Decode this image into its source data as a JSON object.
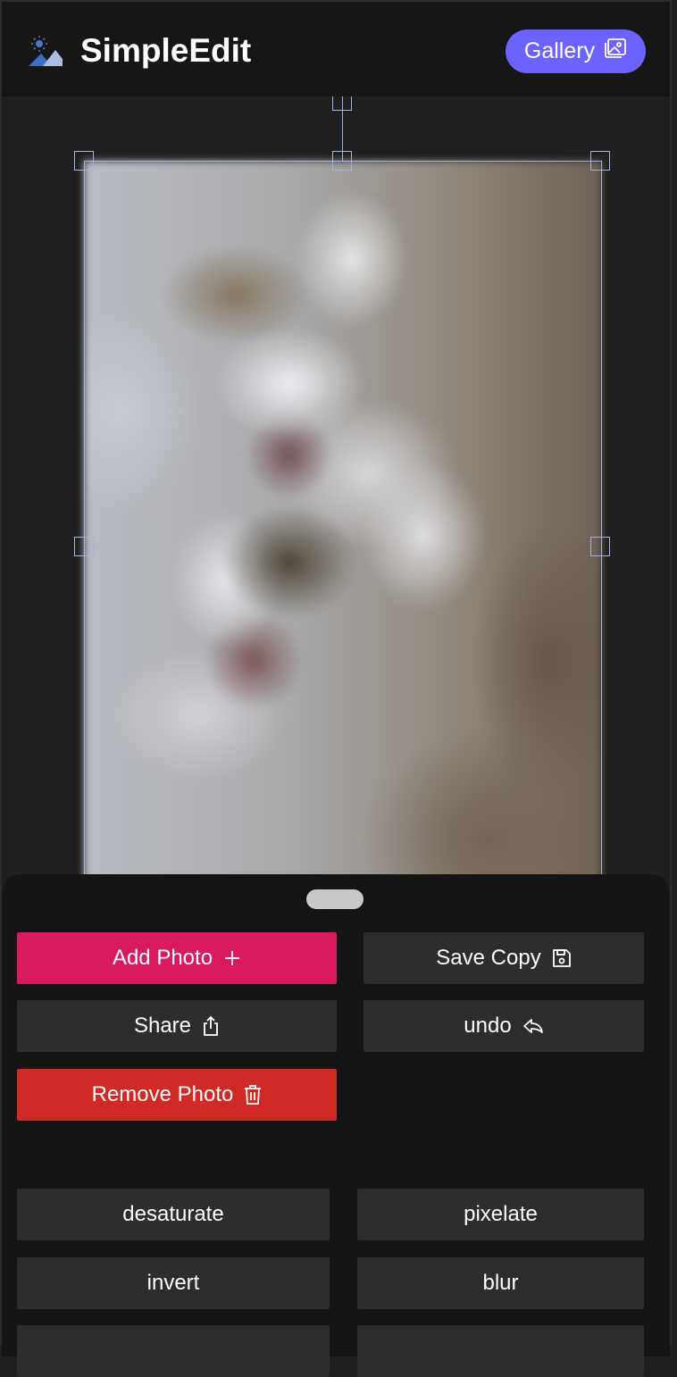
{
  "header": {
    "title": "SimpleEdit",
    "gallery_label": "Gallery"
  },
  "actions": {
    "add_photo": "Add Photo",
    "save_copy": "Save Copy",
    "share": "Share",
    "undo": "undo",
    "remove_photo": "Remove Photo"
  },
  "filters": [
    "desaturate",
    "pixelate",
    "invert",
    "blur"
  ],
  "colors": {
    "accent": "#6c63ff",
    "add_photo": "#d91a5e",
    "remove_photo": "#d12a26",
    "selection": "#9fb4e0"
  }
}
